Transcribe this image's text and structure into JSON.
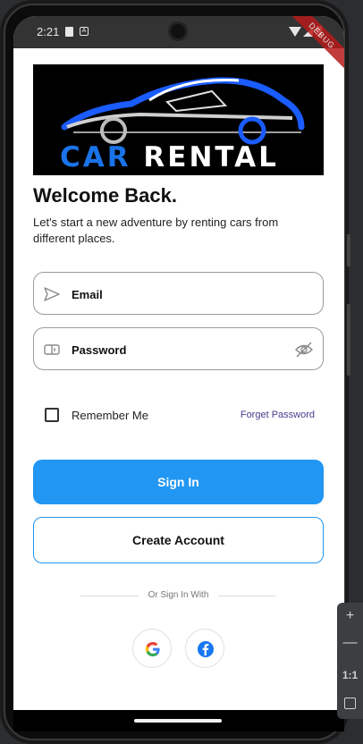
{
  "status_bar": {
    "time": "2:21",
    "debug_label": "DEBUG"
  },
  "logo": {
    "word1": "CAR",
    "word2": "RENTAL"
  },
  "header": {
    "title": "Welcome Back.",
    "subtitle": "Let's start a new adventure by renting cars from different places."
  },
  "form": {
    "email_placeholder": "Email",
    "password_placeholder": "Password",
    "remember_label": "Remember Me",
    "forget_label": "Forget Password"
  },
  "buttons": {
    "sign_in": "Sign In",
    "create_account": "Create Account"
  },
  "divider": {
    "label": "Or Sign In With"
  },
  "social": [
    "google-icon",
    "facebook-icon"
  ],
  "emulator_toolbar": {
    "plus": "+",
    "minus": "—",
    "ratio": "1:1"
  },
  "colors": {
    "primary": "#2196f3",
    "link": "#4a3a8c",
    "logo_blue": "#1a73e8"
  }
}
